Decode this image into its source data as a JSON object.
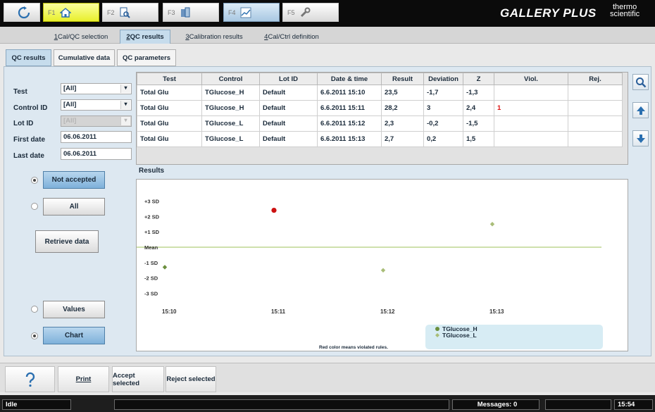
{
  "app": {
    "title": "GALLERY PLUS",
    "brand_line1": "thermo",
    "brand_line2": "scientific"
  },
  "fkeys": [
    {
      "key": "",
      "icon": "refresh-icon"
    },
    {
      "key": "F1",
      "icon": "home-icon"
    },
    {
      "key": "F2",
      "icon": "search-doc-icon"
    },
    {
      "key": "F3",
      "icon": "samples-icon"
    },
    {
      "key": "F4",
      "icon": "chart-icon"
    },
    {
      "key": "F5",
      "icon": "wrench-icon"
    }
  ],
  "main_tabs": [
    {
      "num": "1",
      "label": "Cal/QC selection"
    },
    {
      "num": "2",
      "label": "QC results"
    },
    {
      "num": "3",
      "label": "Calibration results"
    },
    {
      "num": "4",
      "label": "Cal/Ctrl definition"
    }
  ],
  "sub_tabs": [
    "QC results",
    "Cumulative data",
    "QC parameters"
  ],
  "filters": {
    "test_label": "Test",
    "test_value": "[All]",
    "control_label": "Control ID",
    "control_value": "[All]",
    "lot_label": "Lot ID",
    "lot_value": "[All]",
    "first_date_label": "First date",
    "first_date_value": "06.06.2011",
    "last_date_label": "Last date",
    "last_date_value": "06.06.2011"
  },
  "options": {
    "not_accepted": "Not accepted",
    "all": "All",
    "retrieve": "Retrieve data",
    "values": "Values",
    "chart": "Chart"
  },
  "table": {
    "headers": [
      "Test",
      "Control",
      "Lot ID",
      "Date & time",
      "Result",
      "Deviation",
      "Z",
      "Viol.",
      "Rej."
    ],
    "rows": [
      [
        "Total Glu",
        "TGlucose_H",
        "Default",
        "6.6.2011 15:10",
        "23,5",
        "-1,7",
        "-1,3",
        "",
        ""
      ],
      [
        "Total Glu",
        "TGlucose_H",
        "Default",
        "6.6.2011 15:11",
        "28,2",
        "3",
        "2,4",
        "1",
        ""
      ],
      [
        "Total Glu",
        "TGlucose_L",
        "Default",
        "6.6.2011 15:12",
        "2,3",
        "-0,2",
        "-1,5",
        "",
        ""
      ],
      [
        "Total Glu",
        "TGlucose_L",
        "Default",
        "6.6.2011 15:13",
        "2,7",
        "0,2",
        "1,5",
        "",
        ""
      ]
    ]
  },
  "results_label": "Results",
  "chart_data": {
    "type": "scatter",
    "y_tick_labels": [
      "+3 SD",
      "+2 SD",
      "+1 SD",
      "Mean",
      "-1 SD",
      "-2 SD",
      "-3 SD"
    ],
    "y_tick_values": [
      3,
      2,
      1,
      0,
      -1,
      -2,
      -3
    ],
    "x_tick_labels": [
      "15:10",
      "15:11",
      "15:12",
      "15:13"
    ],
    "ylim": [
      -3,
      3
    ],
    "series": [
      {
        "name": "TGlucose_H",
        "color": "#6b8f3e",
        "x": [
          "15:10",
          "15:11"
        ],
        "y": [
          -1.3,
          2.4
        ],
        "violated": [
          false,
          true
        ]
      },
      {
        "name": "TGlucose_L",
        "color": "#a9bd78",
        "x": [
          "15:12",
          "15:13"
        ],
        "y": [
          -1.5,
          1.5
        ],
        "violated": [
          false,
          false
        ]
      }
    ],
    "mean_line_color": "#9cc05a",
    "violation_color": "#cc1111",
    "note": "Red color means violated rules.",
    "legend": "bottom-right"
  },
  "bottom": {
    "help_icon": "question-icon",
    "print": "Print",
    "accept": "Accept selected",
    "reject": "Reject selected"
  },
  "status": {
    "state": "Idle",
    "messages": "Messages: 0",
    "time": "15:54"
  }
}
